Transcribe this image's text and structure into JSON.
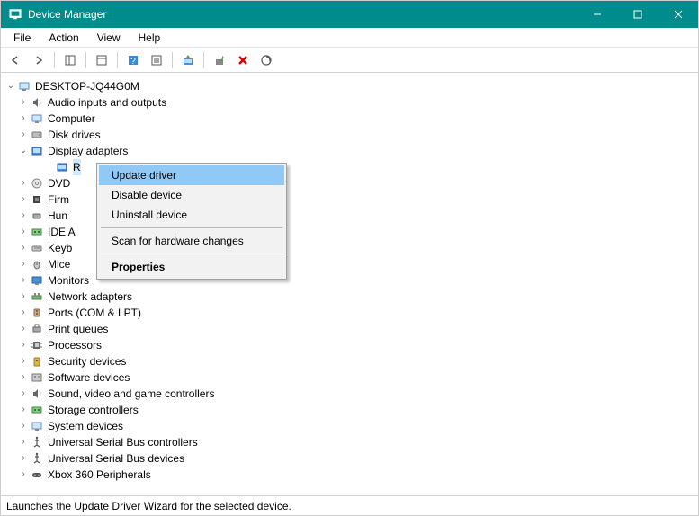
{
  "window": {
    "title": "Device Manager"
  },
  "menubar": {
    "file": "File",
    "action": "Action",
    "view": "View",
    "help": "Help"
  },
  "tree": {
    "root": "DESKTOP-JQ44G0M",
    "audio": "Audio inputs and outputs",
    "computer": "Computer",
    "disk": "Disk drives",
    "display": "Display adapters",
    "display_child": "R",
    "dvd": "DVD",
    "firmware": "Firm",
    "hid": "Hun",
    "ide": "IDE A",
    "keyboards": "Keyb",
    "mice": "Mice",
    "monitors": "Monitors",
    "network": "Network adapters",
    "ports": "Ports (COM & LPT)",
    "printq": "Print queues",
    "processors": "Processors",
    "security": "Security devices",
    "software": "Software devices",
    "sound": "Sound, video and game controllers",
    "storage": "Storage controllers",
    "system": "System devices",
    "usbctrl": "Universal Serial Bus controllers",
    "usbdev": "Universal Serial Bus devices",
    "xbox": "Xbox 360 Peripherals"
  },
  "context_menu": {
    "update": "Update driver",
    "disable": "Disable device",
    "uninstall": "Uninstall device",
    "scan": "Scan for hardware changes",
    "properties": "Properties"
  },
  "statusbar": {
    "text": "Launches the Update Driver Wizard for the selected device."
  }
}
